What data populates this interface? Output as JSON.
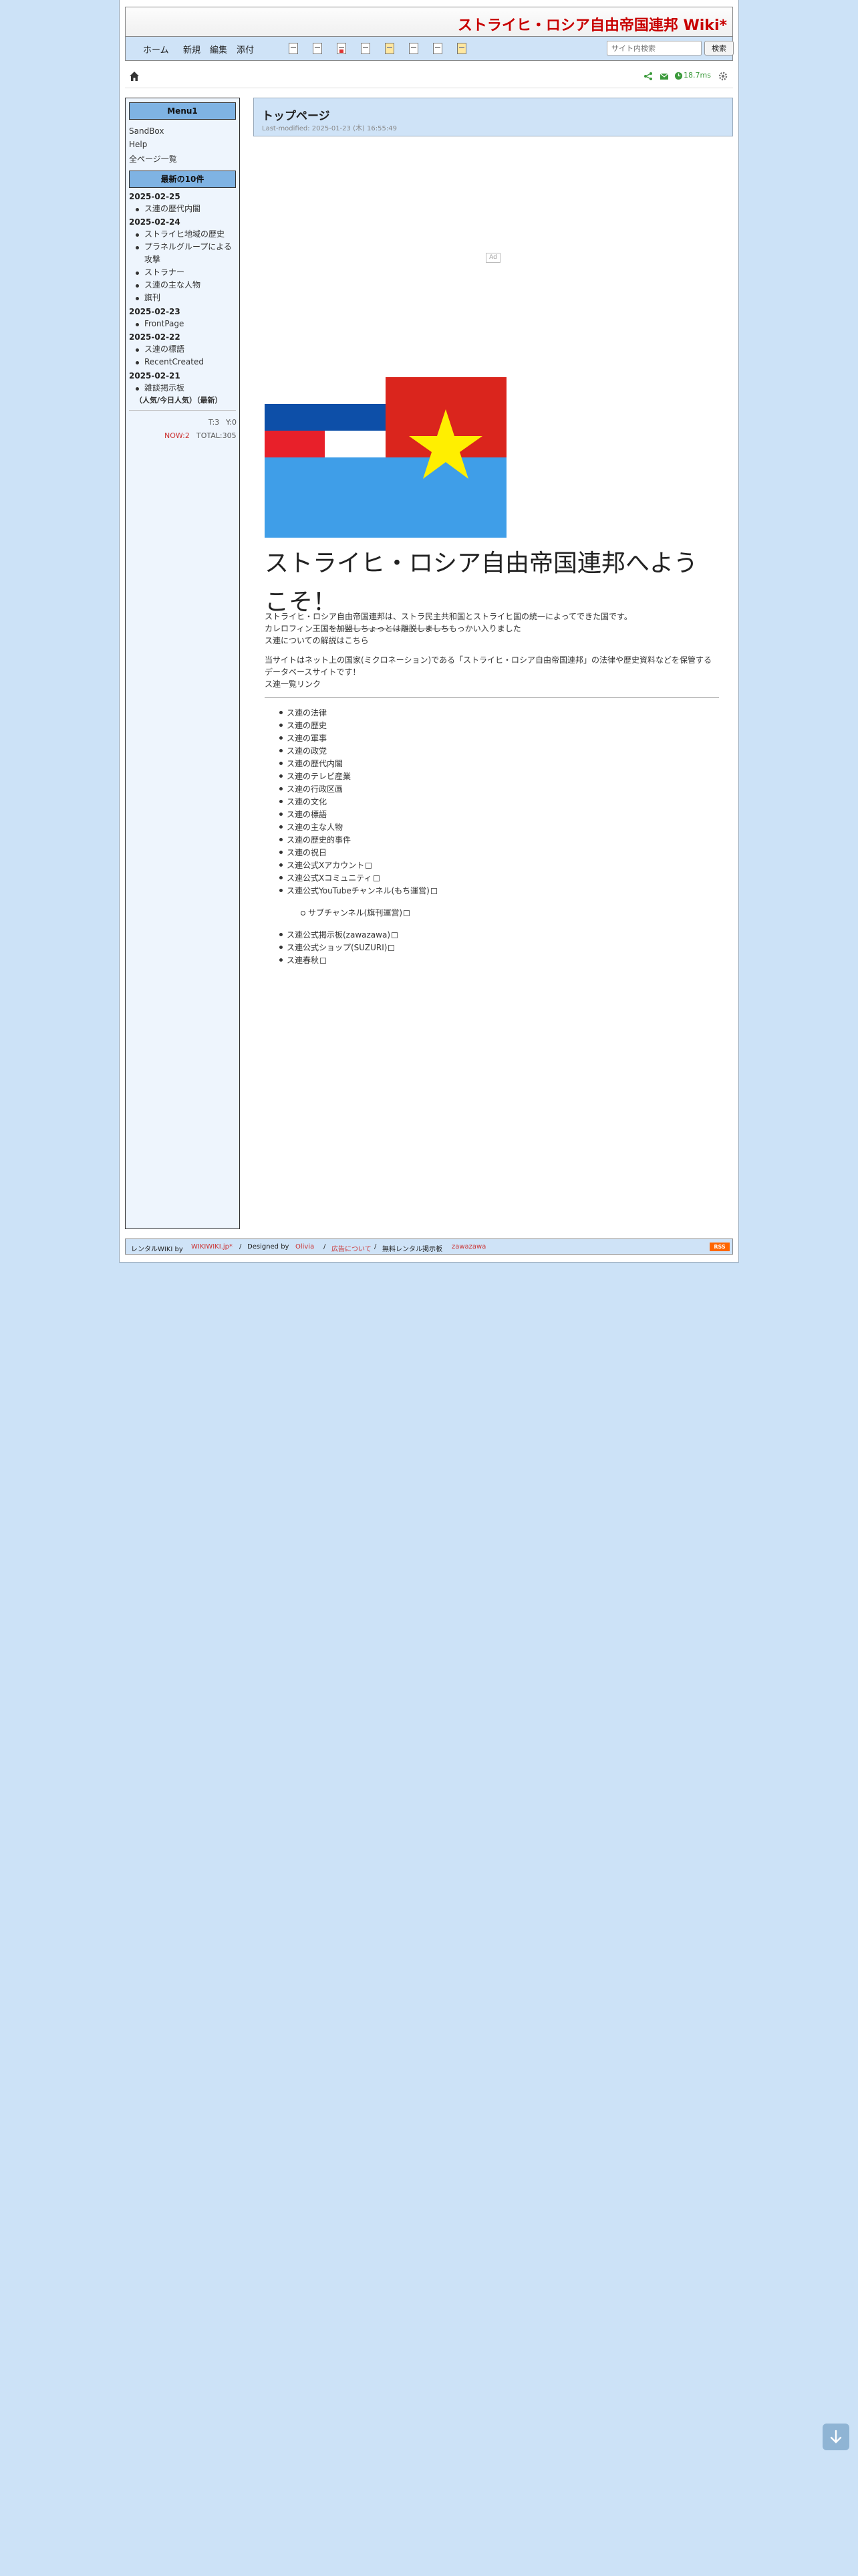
{
  "header": {
    "site_title": "ストライヒ・ロシア自由帝国連邦 Wiki*"
  },
  "toolbar": {
    "links": [
      "ホーム",
      "新規",
      "編集",
      "添付"
    ],
    "search_placeholder": "サイト内検索",
    "search_button": "検索"
  },
  "navline": {
    "speed": "18.7ms"
  },
  "menubar": {
    "menu_title": "Menu1",
    "menu_links": [
      "SandBox",
      "Help",
      "全ページ一覧"
    ],
    "recent_title": "最新の10件",
    "recent": [
      {
        "date": "2025-02-25",
        "items": [
          "ス連の歴代内閣"
        ]
      },
      {
        "date": "2025-02-24",
        "items": [
          "ストライヒ地域の歴史",
          "プラネルグループによる攻撃",
          "ストラナー",
          "ス連の主な人物",
          "旗刊"
        ]
      },
      {
        "date": "2025-02-23",
        "items": [
          "FrontPage"
        ]
      },
      {
        "date": "2025-02-22",
        "items": [
          "ス連の標語",
          "RecentCreated"
        ]
      },
      {
        "date": "2025-02-21",
        "items": [
          "雑談掲示板"
        ]
      }
    ],
    "popular_link": "（人気/今日人気）（最新）",
    "counter_today": "T:3",
    "counter_yesterday": "Y:0",
    "counter_now": "NOW:2",
    "counter_total": "TOTAL:305"
  },
  "body": {
    "page_title": "トップページ",
    "last_modified": "Last-modified: 2025-01-23 (木) 16:55:49",
    "ad_label": "Ad",
    "welcome": "ストライヒ・ロシア自由帝国連邦へようこそ！",
    "intro_1": "ストライヒ・ロシア自由帝国連邦は、ストラ民主共和国とストライヒ国の統一によってできた国です。",
    "intro_2_pre": "カレロフィン王国",
    "intro_2_strike": "を加盟しちょっとは離脱しましち",
    "intro_2_post": "もっかい入りました",
    "intro_3": "ス連についての解説はこちら",
    "intro_4": "当サイトはネット上の国家(ミクロネーション)である「ストライヒ・ロシア自由帝国連邦」の法律や歴史資料などを保管するデータベースサイトです！",
    "intro_5": "ス連一覧リンク",
    "links": [
      "ス連の法律",
      "ス連の歴史",
      "ス連の軍事",
      "ス連の政党",
      "ス連の歴代内閣",
      "ス連のテレビ産業",
      "ス連の行政区画",
      "ス連の文化",
      "ス連の標語",
      "ス連の主な人物",
      "ス連の歴史的事件",
      "ス連の祝日",
      "ス連公式Xアカウント",
      "ス連公式Xコミュニティ",
      "ス連公式YouTubeチャンネル(もち運営)"
    ],
    "sub_link": "サブチャンネル(旗刊運営)",
    "links_after": [
      "ス連公式掲示板(zawazawa)",
      "ス連公式ショップ(SUZURI)",
      "ス連春秋"
    ]
  },
  "footer": {
    "rental": "レンタルWIKI by",
    "wikiwiki": "WIKIWIKI.jp*",
    "designed": "Designed by",
    "olivia": "Olivia",
    "ad_about": "広告について",
    "board": "無料レンタル掲示板",
    "zawazawa": "zawazawa",
    "rss": "RSS"
  },
  "colors": {
    "accent": "#c80000",
    "background": "#cce2f7",
    "menu_head": "#7fb3e3"
  }
}
